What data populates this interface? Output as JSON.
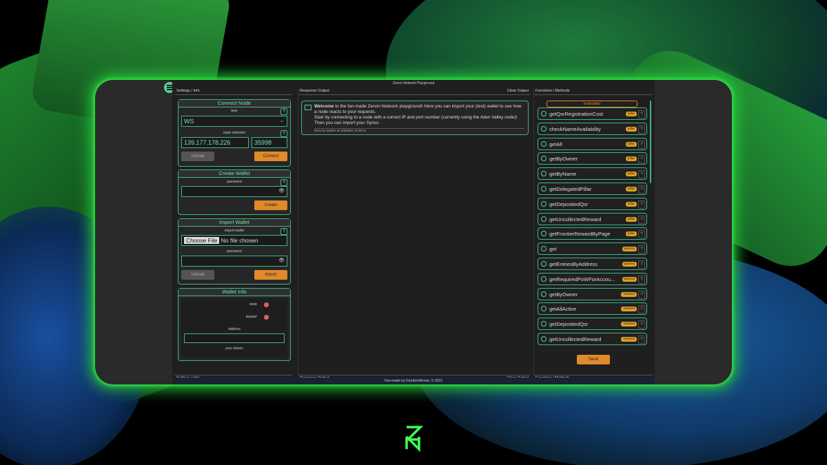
{
  "app": {
    "title": "Zenon Network Playground",
    "footer": "Fan-made by DrunkenMoose, © 2022"
  },
  "left": {
    "header": "Settings / Info",
    "footer": "Settings / Info",
    "connect": {
      "title": "Connect Node",
      "type_label": "type",
      "type_value": "WS",
      "node_label": "node selection",
      "ip": "139.177.178.226",
      "port": "35998",
      "unload": "Unload",
      "connect": "Connect"
    },
    "create": {
      "title": "Create Wallet",
      "password_label": "password",
      "button": "Create"
    },
    "import": {
      "title": "Import Wallet",
      "import_label": "import wallet",
      "choose": "Choose File",
      "no_file": "No file chosen",
      "password_label": "password",
      "unload": "Unload",
      "import": "Import"
    },
    "info": {
      "title": "Wallet Info",
      "node": "node",
      "keypair": "keypair",
      "address": "address",
      "tokens": "your tokens"
    }
  },
  "mid": {
    "header": "Response Output",
    "clear": "Clear Output",
    "footer": "Response Output",
    "footer_clear": "Clear Output",
    "message": {
      "bold": "Welcome",
      "text": " to the fan-made Zenon Network playground! Here you can import your (test) wallet to see how a node reacts to your requests.",
      "text2": "Start by connecting to a node with a correct IP and port number (currently using the Alien Valley node)! Then you can import your Syrius",
      "meta": "done by system on 4/5/2022 15:39:41"
    }
  },
  "right": {
    "header": "Functions / Methods",
    "footer": "Functions / Methods",
    "embedded": "Embedded",
    "send": "Send",
    "functions": [
      {
        "name": "getQsrRegistrationCost",
        "tag": "pillar"
      },
      {
        "name": "checkNameAvailability",
        "tag": "pillar"
      },
      {
        "name": "getAll",
        "tag": "pillar"
      },
      {
        "name": "getByOwner",
        "tag": "pillar"
      },
      {
        "name": "getByName",
        "tag": "pillar"
      },
      {
        "name": "getDelegatedPillar",
        "tag": "pillar"
      },
      {
        "name": "getDepositedQsr",
        "tag": "pillar"
      },
      {
        "name": "getUncollectedReward",
        "tag": "pillar"
      },
      {
        "name": "getFrontierRewardByPage",
        "tag": "pillar"
      },
      {
        "name": "get",
        "tag": "plasma"
      },
      {
        "name": "getEntriesByAddress",
        "tag": "plasma"
      },
      {
        "name": "getRequiredPoWForAccou...",
        "tag": "plasma"
      },
      {
        "name": "getByOwner",
        "tag": "sentinel"
      },
      {
        "name": "getAllActive",
        "tag": "sentinel"
      },
      {
        "name": "getDepositedQsr",
        "tag": "sentinel"
      },
      {
        "name": "getUncollectedReward",
        "tag": "sentinel"
      }
    ]
  },
  "colors": {
    "accent": "#3fb58a",
    "orange": "#e08a2a",
    "glow": "#28d23c",
    "red_dot": "#e06060"
  }
}
